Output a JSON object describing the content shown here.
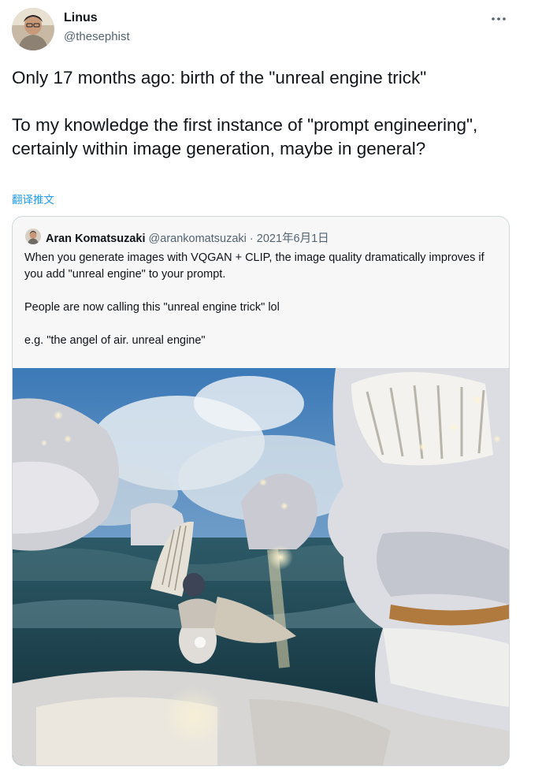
{
  "tweet": {
    "author_name": "Linus",
    "author_handle": "@thesephist",
    "more_icon": "more-horizontal-icon",
    "text": "Only 17 months ago: birth of the \"unreal engine trick\"\n\nTo my knowledge the first instance of \"prompt engineering\", certainly within image generation, maybe in general?",
    "translate_label": "翻译推文"
  },
  "quote": {
    "author_name": "Aran Komatsuzaki",
    "author_handle": "@arankomatsuzaki",
    "separator": " · ",
    "date": "2021年6月1日",
    "paragraphs": [
      "When you generate images with VQGAN + CLIP, the image quality dramatically improves if you add \"unreal engine\" to your prompt.",
      "People are now calling this \"unreal engine trick\" lol",
      "e.g. \"the angel of air. unreal engine\""
    ]
  },
  "colors": {
    "text": "#0f1419",
    "secondary": "#536471",
    "link": "#1d9bf0",
    "border": "#cfd9de",
    "card_bg": "#f7f7f7"
  }
}
